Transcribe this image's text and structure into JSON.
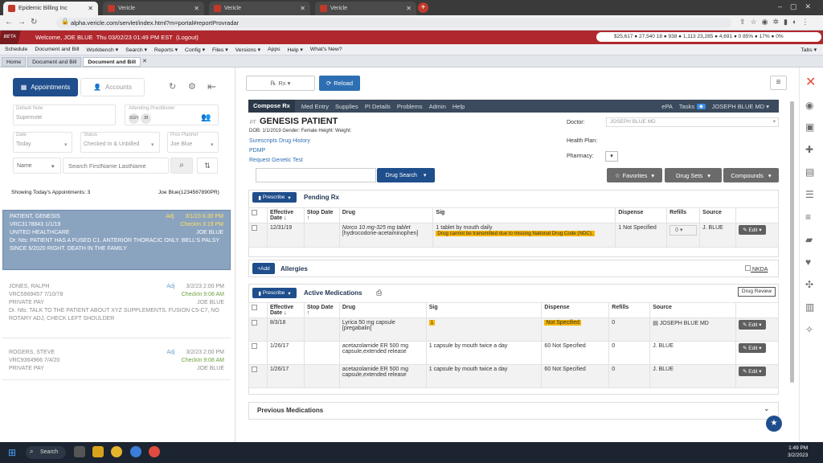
{
  "browser": {
    "tabs": [
      {
        "label": "Epidemic Billing Inc"
      },
      {
        "label": "Vericle"
      },
      {
        "label": "Vericle"
      }
    ],
    "url": "alpha.vericle.com/servlet/index.html?m=portal#reportProvradar"
  },
  "app": {
    "beta_label": "BETA",
    "welcome": "Welcome, JOE BLUE",
    "datetime": "Thu 03/02/23 01:49 PM EST",
    "logout": "(Logout)",
    "stats": "$25,617 ● 27,540  18 ● 938 ● 1,113  23,285 ● 4,691 ● 0  85% ● 17% ● 0%",
    "menu": [
      "Schedule",
      "Document and Bill",
      "Workbench ▾",
      "Search ▾",
      "Reports ▾",
      "Config ▾",
      "Files ▾",
      "Versions ▾",
      "Apps",
      "Help ▾",
      "What's New?"
    ],
    "menu_right": "Tabs ▾",
    "page_tabs": [
      "Home",
      "Document and Bill",
      "Document and Bill"
    ]
  },
  "left": {
    "appointments_btn": "Appointments",
    "accounts_btn": "Accounts",
    "default_note_label": "Default Note",
    "default_note_value": "Supernote",
    "attending_label": "Attending Practitioner",
    "initials": [
      "SGH",
      "JB"
    ],
    "date_label": "Date",
    "date_value": "Today",
    "status_label": "Status",
    "status_value": "Checked In & Unbilled",
    "prov_label": "Prov Planner",
    "prov_value": "Joe Blue",
    "name_select": "Name",
    "search_placeholder": "Search FirstName LastName",
    "showing": "Showing Today's Appointments: 3",
    "showing_user": "Joe Blue(1234567890PR)",
    "appointments": [
      {
        "name": "PATIENT, GENESIS",
        "adj": "Adj",
        "date": "3/1/23 6:30 PM",
        "line2": "VRC3178843 1/1/19",
        "checkin": "CheckIn 3:19 PM",
        "plan": "UNITED HEALTHCARE",
        "prov": "JOE BLUE",
        "note": "Dr. Nts: PATIENT HAS A FUSED C1. ANTERIOR THORACIC ONLY. BELL'S PALSY SINCE 6/2020 RIGHT. DEATH IN THE FAMILY"
      },
      {
        "name": "JONES, RALPH",
        "adj": "Adj",
        "date": "3/2/23 2:00 PM",
        "line2": "VRC5969457 7/10/78",
        "checkin": "CheckIn 9:08 AM",
        "plan": "PRIVATE PAY",
        "prov": "JOE BLUE",
        "note": "Dr. Nts: TALK TO THE PATIENT ABOUT XYZ SUPPLEMENTS. FUSION C5-C7, NO ROTARY ADJ, CHECK LEFT SHOULDER"
      },
      {
        "name": "ROGERS, STEVE",
        "adj": "Adj",
        "date": "3/2/23 2:00 PM",
        "line2": "VRC9364966 7/4/20",
        "checkin": "CheckIn 9:08 AM",
        "plan": "PRIVATE PAY",
        "prov": "JOE BLUE",
        "note": ""
      }
    ]
  },
  "rx": {
    "rx_select": "Rx ▾",
    "reload": "Reload",
    "nav": [
      "Compose Rx",
      "Med Entry",
      "Supplies",
      "PI Details",
      "Problems",
      "Admin",
      "Help"
    ],
    "nav_right": [
      "ePA",
      "Tasks",
      "JOSEPH BLUE MD ▾"
    ],
    "pt_label": "PT",
    "patient_name": "GENESIS PATIENT",
    "demographics": "DOB: 1/1/2019  Gender: Female  Height:  Weight:",
    "links": [
      "Surescripts Drug History",
      "PDMP",
      "Request Genetic Test"
    ],
    "doctor_label": "Doctor:",
    "doctor_value": "JOSEPH BLUE MD",
    "health_plan_label": "Health Plan:",
    "pharmacy_label": "Pharmacy:",
    "drug_search": "Drug Search",
    "favorites": "Favorites",
    "drug_sets": "Drug Sets",
    "compounds": "Compounds",
    "prescribe": "Prescribe",
    "pending_title": "Pending Rx",
    "pending_cols": [
      "Effective Date",
      "Stop Date",
      "Drug",
      "Sig",
      "Dispense",
      "Refills",
      "Source"
    ],
    "pending_rows": [
      {
        "eff": "12/31/19",
        "stop": "",
        "drug": "Norco 10 mg-325 mg tablet",
        "drug2": "[hydrocodone-acetaminophen]",
        "sig": "1 tablet by mouth daily",
        "warn": "Drug cannot be transmitted due to missing National Drug Code (NDC).",
        "dispense": "1 Not Specified",
        "refills": "0",
        "source": "J. BLUE",
        "edit": "Edit"
      }
    ],
    "add": "Add",
    "allergies_title": "Allergies",
    "nkda": "NKDA",
    "active_title": "Active Medications",
    "drug_review": "Drug Review",
    "active_cols": [
      "Effective Date",
      "Stop Date",
      "Drug",
      "Sig",
      "Dispense",
      "Refills",
      "Source"
    ],
    "active_rows": [
      {
        "eff": "8/3/18",
        "drug": "Lyrica 50 mg capsule",
        "drug2": "[pregabalin]",
        "sig": "1",
        "dispense": "Not Specified",
        "refills": "0",
        "source": "JOSEPH BLUE MD",
        "edit": "Edit"
      },
      {
        "eff": "1/26/17",
        "drug": "acetazolamide ER 500 mg",
        "drug2": "capsule,extended release",
        "sig": "1 capsule by mouth twice a day",
        "dispense": "60 Not Specified",
        "refills": "0",
        "source": "J. BLUE",
        "edit": "Edit"
      },
      {
        "eff": "1/26/17",
        "drug": "acetazolamide ER 500 mg",
        "drug2": "capsule,extended release",
        "sig": "1 capsule by mouth twice a day",
        "dispense": "60 Not Specified",
        "refills": "0",
        "source": "J. BLUE",
        "edit": "Edit"
      }
    ],
    "previous_title": "Previous Medications"
  },
  "taskbar": {
    "search": "Search",
    "time": "1:49 PM",
    "date": "3/2/2023"
  },
  "colors": {
    "brand_red": "#b0272d",
    "nav_blue": "#1f4e8c",
    "warn": "#f5b400"
  }
}
